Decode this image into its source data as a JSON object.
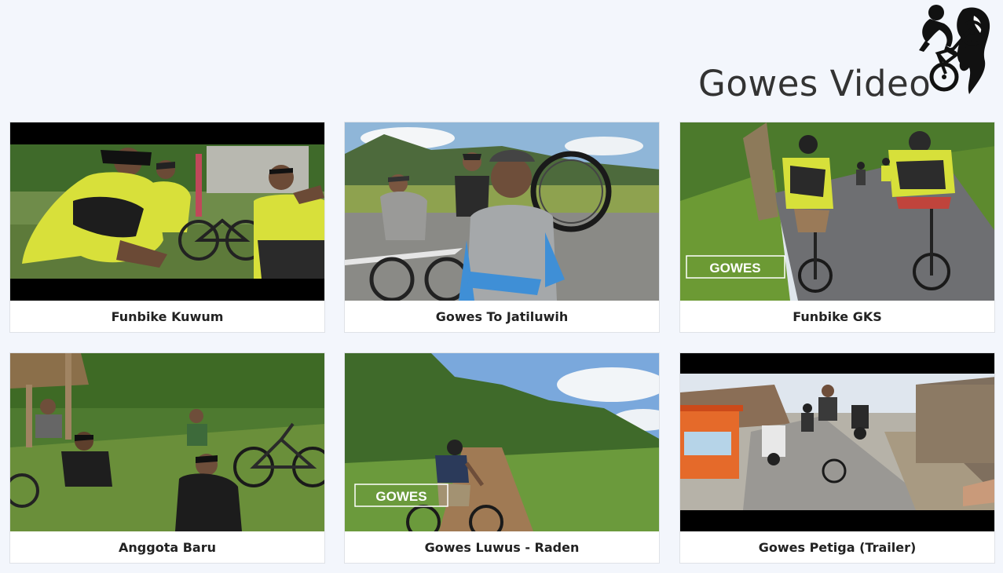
{
  "header": {
    "title": "Gowes Video",
    "logo_icon": "downhill-cyclist-logo-icon"
  },
  "videos": [
    {
      "title": "Funbike Kuwum"
    },
    {
      "title": "Gowes To Jatiluwih"
    },
    {
      "title": "Funbike GKS",
      "watermark": "GOWES"
    },
    {
      "title": "Anggota Baru"
    },
    {
      "title": "Gowes Luwus - Raden",
      "watermark": "GOWES"
    },
    {
      "title": "Gowes Petiga (Trailer)"
    }
  ],
  "colors": {
    "background": "#f3f6fc",
    "card": "#ffffff",
    "title_text": "#333333"
  }
}
